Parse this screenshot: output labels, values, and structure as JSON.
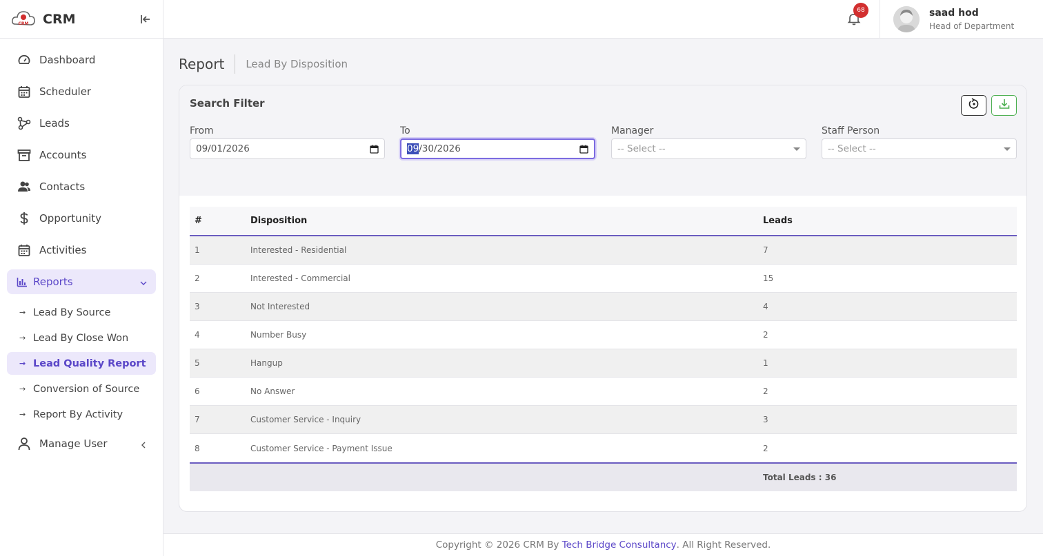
{
  "brand": {
    "name": "CRM",
    "logo_text": "CRM"
  },
  "nav": {
    "items": [
      {
        "label": "Dashboard",
        "icon": "gauge-icon"
      },
      {
        "label": "Scheduler",
        "icon": "calendar-icon"
      },
      {
        "label": "Leads",
        "icon": "share-nodes-icon"
      },
      {
        "label": "Accounts",
        "icon": "archive-icon"
      },
      {
        "label": "Contacts",
        "icon": "users-icon"
      },
      {
        "label": "Opportunity",
        "icon": "dollar-icon"
      },
      {
        "label": "Activities",
        "icon": "calendar-icon"
      }
    ],
    "reports": {
      "label": "Reports",
      "sub_items": [
        {
          "label": "Lead By Source"
        },
        {
          "label": "Lead By Close Won"
        },
        {
          "label": "Lead Quality Report"
        },
        {
          "label": "Conversion of Source"
        },
        {
          "label": "Report By Activity"
        }
      ]
    },
    "manage_user": {
      "label": "Manage User"
    }
  },
  "topbar": {
    "notification_count": "68",
    "user": {
      "name": "saad hod",
      "role": "Head of Department"
    }
  },
  "page": {
    "title": "Report",
    "subtitle": "Lead By Disposition"
  },
  "filter": {
    "title": "Search Filter",
    "from": {
      "label": "From",
      "value": "09/01/2026"
    },
    "to": {
      "label": "To",
      "value_selected": "09",
      "value_rest": "/30/2026"
    },
    "manager": {
      "label": "Manager",
      "placeholder": "-- Select --"
    },
    "staff": {
      "label": "Staff Person",
      "placeholder": "-- Select --"
    }
  },
  "table": {
    "headers": [
      "#",
      "Disposition",
      "Leads"
    ],
    "rows": [
      {
        "num": "1",
        "disposition": "Interested - Residential",
        "leads": "7"
      },
      {
        "num": "2",
        "disposition": "Interested - Commercial",
        "leads": "15"
      },
      {
        "num": "3",
        "disposition": "Not Interested",
        "leads": "4"
      },
      {
        "num": "4",
        "disposition": "Number Busy",
        "leads": "2"
      },
      {
        "num": "5",
        "disposition": "Hangup",
        "leads": "1"
      },
      {
        "num": "6",
        "disposition": "No Answer",
        "leads": "2"
      },
      {
        "num": "7",
        "disposition": "Customer Service - Inquiry",
        "leads": "3"
      },
      {
        "num": "8",
        "disposition": "Customer Service - Payment Issue",
        "leads": "2"
      }
    ],
    "total": "Total Leads : 36"
  },
  "footer": {
    "prefix": "Copyright © 2026 CRM By ",
    "link": "Tech Bridge Consultancy",
    "suffix": ". All Right Reserved."
  }
}
